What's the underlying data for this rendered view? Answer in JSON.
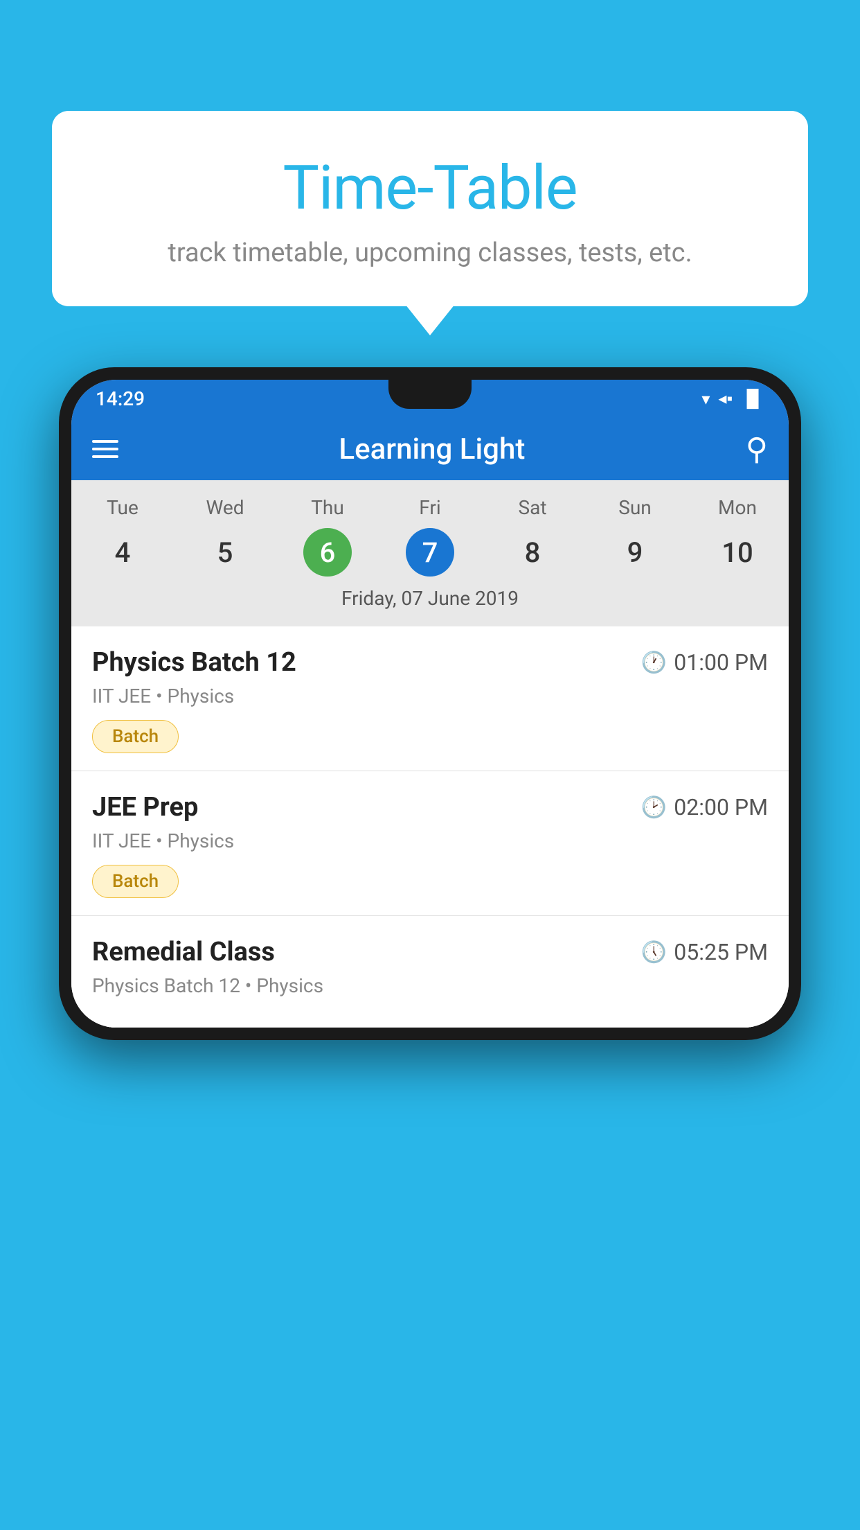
{
  "background_color": "#29B6E8",
  "speech_bubble": {
    "title": "Time-Table",
    "subtitle": "track timetable, upcoming classes, tests, etc."
  },
  "status_bar": {
    "time": "14:29",
    "wifi_icon": "▾",
    "signal_icon": "◂",
    "battery_icon": "▐"
  },
  "app_bar": {
    "title": "Learning Light",
    "menu_label": "menu",
    "search_label": "search"
  },
  "calendar": {
    "days": [
      "Tue",
      "Wed",
      "Thu",
      "Fri",
      "Sat",
      "Sun",
      "Mon"
    ],
    "numbers": [
      "4",
      "5",
      "6",
      "7",
      "8",
      "9",
      "10"
    ],
    "today_index": 2,
    "selected_index": 3,
    "selected_date": "Friday, 07 June 2019"
  },
  "schedule": {
    "items": [
      {
        "title": "Physics Batch 12",
        "time": "01:00 PM",
        "subtitle": "IIT JEE • Physics",
        "badge": "Batch"
      },
      {
        "title": "JEE Prep",
        "time": "02:00 PM",
        "subtitle": "IIT JEE • Physics",
        "badge": "Batch"
      },
      {
        "title": "Remedial Class",
        "time": "05:25 PM",
        "subtitle": "Physics Batch 12 • Physics",
        "badge": ""
      }
    ]
  }
}
